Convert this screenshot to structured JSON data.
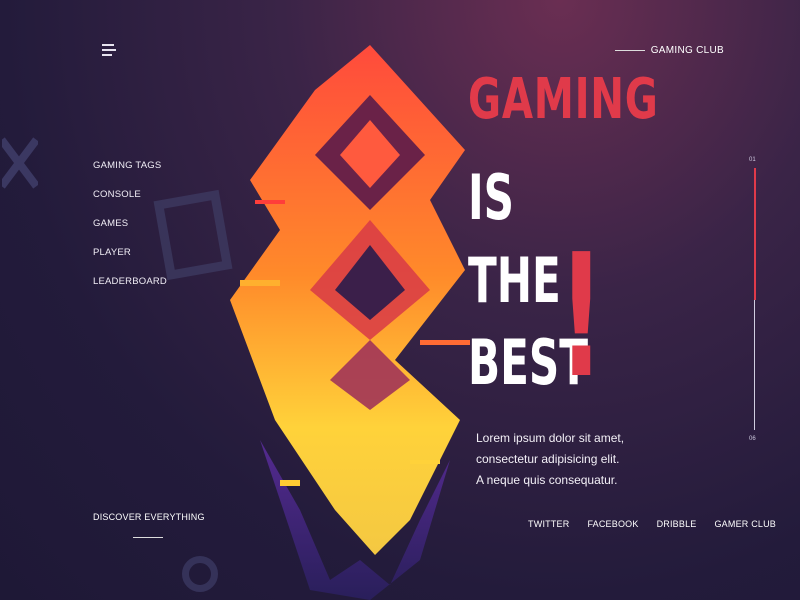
{
  "header": {
    "menu_icon": "hamburger-icon",
    "brand": "GAMING CLUB"
  },
  "nav": {
    "items": [
      "GAMING TAGS",
      "CONSOLE",
      "GAMES",
      "PLAYER",
      "LEADERBOARD"
    ]
  },
  "hero": {
    "line1": "GAMING",
    "line2": "IS",
    "line3": "THE",
    "line4": "BEST",
    "exclamation": "!",
    "description_lines": [
      "Lorem ipsum dolor sit amet,",
      "consectetur adipisicing elit.",
      "A neque quis consequatur."
    ]
  },
  "scroll": {
    "start": "01",
    "end": "06"
  },
  "footer": {
    "discover": "DISCOVER EVERYTHING",
    "social": [
      "TWITTER",
      "FACEBOOK",
      "DRIBBLE",
      "GAMER CLUB"
    ]
  },
  "colors": {
    "accent": "#e03a4a",
    "background": "#231b3b",
    "text": "#ffffff"
  }
}
